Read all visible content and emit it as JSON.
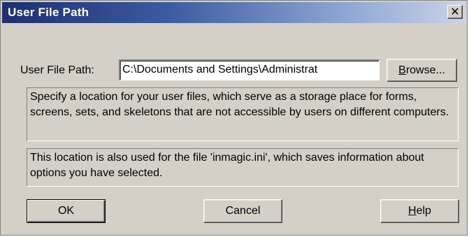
{
  "window": {
    "title": "User File Path",
    "close_glyph": "✕"
  },
  "form": {
    "path_label": "User File Path:",
    "path_value": "C:\\Documents and Settings\\Administrat",
    "browse_label_pre": "",
    "browse_label_key": "B",
    "browse_label_post": "rowse..."
  },
  "info": {
    "description": "Specify a location for your user files, which serve as a storage place for forms, screens, sets, and skeletons that are not accessible by users on different computers.",
    "ini_note": "This location is also used for the file 'inmagic.ini', which saves information about options you have selected."
  },
  "buttons": {
    "ok_label": "OK",
    "cancel_label": "Cancel",
    "help_key": "H",
    "help_rest": "elp"
  }
}
